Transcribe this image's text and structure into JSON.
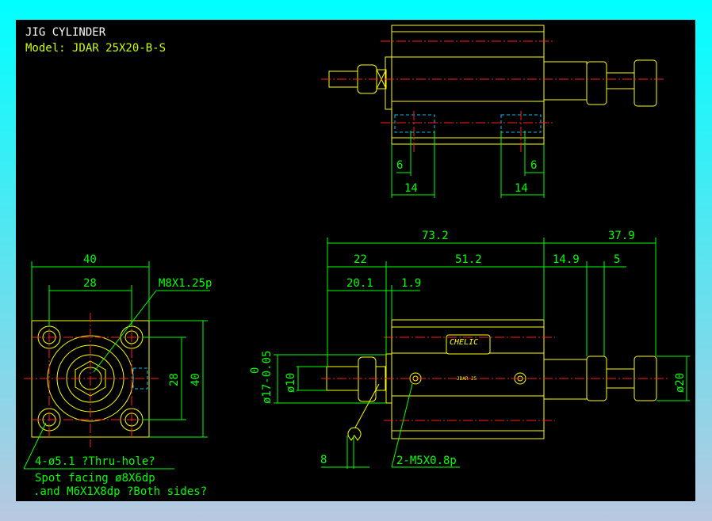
{
  "title": "JIG CYLINDER",
  "model": "Model: JDAR 25X20-B-S",
  "colors": {
    "frame": "#00ffff",
    "canvas": "#000000",
    "outline": "#ffff00",
    "dimension": "#00ff00",
    "centerline": "#ff2020",
    "hidden": "#00c0ff"
  },
  "top_view": {
    "dims": [
      "6",
      "6",
      "14",
      "14"
    ]
  },
  "front_view": {
    "dims": {
      "overall": "73.2",
      "stroke_ext": "37.9",
      "d22": "22",
      "d51": "51.2",
      "d149": "14.9",
      "d5": "5",
      "d201": "20.1",
      "d19": "1.9",
      "rod_dia": "ø10",
      "boss_dia": "ø17-0.05",
      "boss_tol_top": "0",
      "knob_dia": "ø20",
      "wrench": "8"
    },
    "port_note": "2-M5X0.8p",
    "label_brand": "CHELIC",
    "label_model": "JDAR 25"
  },
  "side_view": {
    "dims": {
      "w40": "40",
      "w28": "28",
      "h28": "28",
      "h40": "40"
    },
    "thread_note": "M8X1.25p",
    "notes": [
      "4-ø5.1 ?Thru-hole?",
      "Spot facing  ø8X6dp",
      ".and M6X1X8dp ?Both sides?"
    ]
  }
}
